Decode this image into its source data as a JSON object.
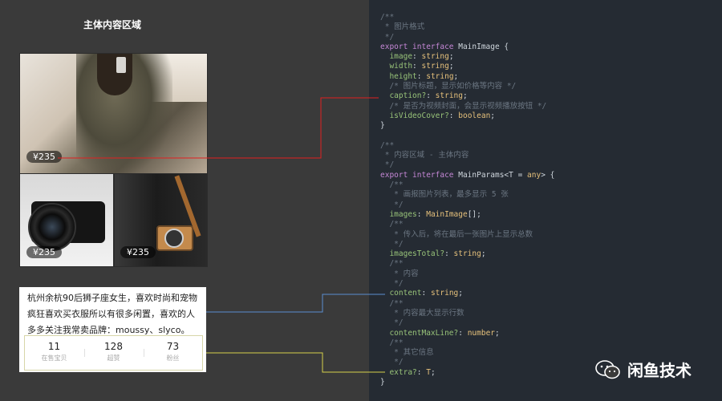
{
  "left": {
    "title": "主体内容区域",
    "images": [
      {
        "price": "¥235",
        "icon": "photo-woman-mirror-selfie"
      },
      {
        "price": "¥235",
        "icon": "photo-black-camera"
      },
      {
        "price": "¥235",
        "icon": "photo-brown-camera"
      }
    ],
    "content_lines": [
      "杭州余杭90后狮子座女生，喜欢时尚和宠物",
      "疯狂喜欢买衣服所以有很多闲置，喜欢的人",
      "多多关注我常卖品牌：moussy、slyco。"
    ],
    "stats": [
      {
        "value": "11",
        "label": "在售宝贝"
      },
      {
        "value": "128",
        "label": "超赞"
      },
      {
        "value": "73",
        "label": "粉丝"
      }
    ]
  },
  "code_lines": [
    [
      {
        "t": "/**",
        "c": "cmt"
      }
    ],
    [
      {
        "t": " * 图片格式",
        "c": "cmt"
      }
    ],
    [
      {
        "t": " */",
        "c": "cmt"
      }
    ],
    [
      {
        "t": "export interface ",
        "c": "kw"
      },
      {
        "t": "MainImage {",
        "c": ""
      }
    ],
    [
      {
        "t": "  image",
        "c": "prop"
      },
      {
        "t": ": ",
        "c": ""
      },
      {
        "t": "string",
        "c": "type"
      },
      {
        "t": ";",
        "c": ""
      }
    ],
    [
      {
        "t": "  width",
        "c": "prop"
      },
      {
        "t": ": ",
        "c": ""
      },
      {
        "t": "string",
        "c": "type"
      },
      {
        "t": ";",
        "c": ""
      }
    ],
    [
      {
        "t": "  height",
        "c": "prop"
      },
      {
        "t": ": ",
        "c": ""
      },
      {
        "t": "string",
        "c": "type"
      },
      {
        "t": ";",
        "c": ""
      }
    ],
    [
      {
        "t": "  /* 图片标题，显示如价格等内容 */",
        "c": "cmt"
      }
    ],
    [
      {
        "t": "  caption?",
        "c": "prop"
      },
      {
        "t": ": ",
        "c": ""
      },
      {
        "t": "string",
        "c": "type"
      },
      {
        "t": ";",
        "c": ""
      }
    ],
    [
      {
        "t": "  /* 是否为视频封面，会显示视频播放按钮 */",
        "c": "cmt"
      }
    ],
    [
      {
        "t": "  isVideoCover?",
        "c": "prop"
      },
      {
        "t": ": ",
        "c": ""
      },
      {
        "t": "boolean",
        "c": "type"
      },
      {
        "t": ";",
        "c": ""
      }
    ],
    [
      {
        "t": "}",
        "c": ""
      }
    ],
    [
      {
        "t": "",
        "c": ""
      }
    ],
    [
      {
        "t": "/**",
        "c": "cmt"
      }
    ],
    [
      {
        "t": " * 内容区域 - 主体内容",
        "c": "cmt"
      }
    ],
    [
      {
        "t": " */",
        "c": "cmt"
      }
    ],
    [
      {
        "t": "export interface ",
        "c": "kw"
      },
      {
        "t": "MainParams<T = ",
        "c": ""
      },
      {
        "t": "any",
        "c": "type"
      },
      {
        "t": "> {",
        "c": ""
      }
    ],
    [
      {
        "t": "  /**",
        "c": "cmt"
      }
    ],
    [
      {
        "t": "   * 画报图片列表，最多显示 5 张",
        "c": "cmt"
      }
    ],
    [
      {
        "t": "   */",
        "c": "cmt"
      }
    ],
    [
      {
        "t": "  images",
        "c": "prop"
      },
      {
        "t": ": ",
        "c": ""
      },
      {
        "t": "MainImage",
        "c": "type"
      },
      {
        "t": "[];",
        "c": ""
      }
    ],
    [
      {
        "t": "  /**",
        "c": "cmt"
      }
    ],
    [
      {
        "t": "   * 传入后，将在最后一张图片上显示总数",
        "c": "cmt"
      }
    ],
    [
      {
        "t": "   */",
        "c": "cmt"
      }
    ],
    [
      {
        "t": "  imagesTotal?",
        "c": "prop"
      },
      {
        "t": ": ",
        "c": ""
      },
      {
        "t": "string",
        "c": "type"
      },
      {
        "t": ";",
        "c": ""
      }
    ],
    [
      {
        "t": "  /**",
        "c": "cmt"
      }
    ],
    [
      {
        "t": "   * 内容",
        "c": "cmt"
      }
    ],
    [
      {
        "t": "   */",
        "c": "cmt"
      }
    ],
    [
      {
        "t": "  content",
        "c": "prop"
      },
      {
        "t": ": ",
        "c": ""
      },
      {
        "t": "string",
        "c": "type"
      },
      {
        "t": ";",
        "c": ""
      }
    ],
    [
      {
        "t": "  /**",
        "c": "cmt"
      }
    ],
    [
      {
        "t": "   * 内容最大显示行数",
        "c": "cmt"
      }
    ],
    [
      {
        "t": "   */",
        "c": "cmt"
      }
    ],
    [
      {
        "t": "  contentMaxLine?",
        "c": "prop"
      },
      {
        "t": ": ",
        "c": ""
      },
      {
        "t": "number",
        "c": "type"
      },
      {
        "t": ";",
        "c": ""
      }
    ],
    [
      {
        "t": "  /**",
        "c": "cmt"
      }
    ],
    [
      {
        "t": "   * 其它信息",
        "c": "cmt"
      }
    ],
    [
      {
        "t": "   */",
        "c": "cmt"
      }
    ],
    [
      {
        "t": "  extra?",
        "c": "prop"
      },
      {
        "t": ": ",
        "c": ""
      },
      {
        "t": "T",
        "c": "type"
      },
      {
        "t": ";",
        "c": ""
      }
    ],
    [
      {
        "t": "}",
        "c": ""
      }
    ]
  ],
  "connector_colors": {
    "caption": "#e02020",
    "content": "#5a8fd0",
    "extra": "#d6d04a"
  },
  "brand": {
    "name": "闲鱼技术",
    "icon": "wechat-logo-icon"
  }
}
